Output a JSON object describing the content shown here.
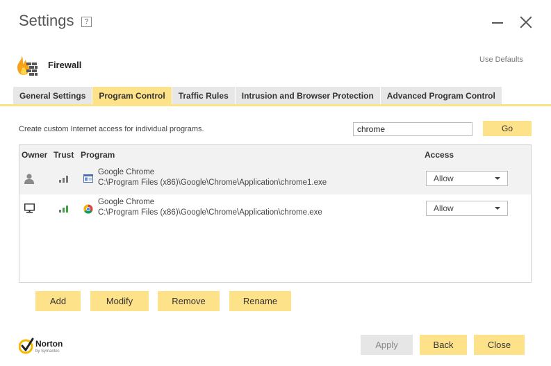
{
  "window": {
    "title": "Settings",
    "help_label": "?"
  },
  "section": {
    "title": "Firewall",
    "use_defaults": "Use Defaults"
  },
  "tabs": [
    {
      "label": "General Settings",
      "active": false
    },
    {
      "label": "Program Control",
      "active": true
    },
    {
      "label": "Traffic Rules",
      "active": false
    },
    {
      "label": "Intrusion and Browser Protection",
      "active": false
    },
    {
      "label": "Advanced Program Control",
      "active": false
    }
  ],
  "description": "Create custom Internet access for individual programs.",
  "search": {
    "value": "chrome",
    "go_label": "Go"
  },
  "table": {
    "columns": [
      "Owner",
      "Trust",
      "Program",
      "Access"
    ],
    "rows": [
      {
        "owner_icon": "user-icon",
        "trust_icon": "signal-bars-gray-icon",
        "program_icon": "app-window-icon",
        "name": "Google Chrome",
        "path": "C:\\Program Files (x86)\\Google\\Chrome\\Application\\chrome1.exe",
        "access": "Allow",
        "selected": true
      },
      {
        "owner_icon": "computer-icon",
        "trust_icon": "signal-bars-green-icon",
        "program_icon": "chrome-icon",
        "name": "Google Chrome",
        "path": "C:\\Program Files (x86)\\Google\\Chrome\\Application\\chrome.exe",
        "access": "Allow",
        "selected": false
      }
    ]
  },
  "actions": {
    "add": "Add",
    "modify": "Modify",
    "remove": "Remove",
    "rename": "Rename"
  },
  "footer": {
    "logo_text": "Norton",
    "logo_sub": "by Symantec",
    "apply": "Apply",
    "back": "Back",
    "close": "Close"
  },
  "colors": {
    "accent": "#fee28a",
    "tab_inactive": "#e7e7e7",
    "trust_green": "#3fa33f",
    "trust_gray": "#777777"
  }
}
